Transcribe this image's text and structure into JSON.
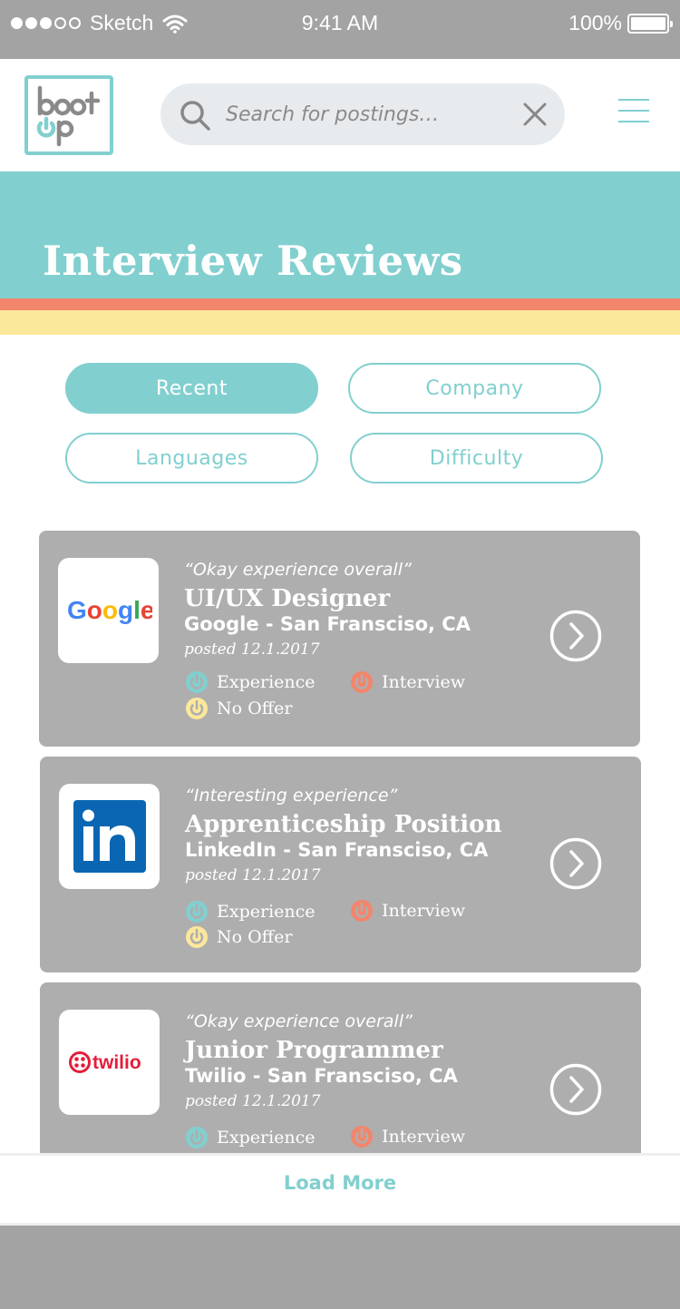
{
  "status_bar": {
    "carrier": "Sketch",
    "time": "9:41 AM",
    "battery": "100%",
    "signal_bars_filled": 3,
    "signal_bars_total": 5
  },
  "header": {
    "logo_text": "boot up",
    "search_placeholder": "Search for postings…",
    "search_value": "",
    "icons": [
      "search-icon",
      "close-icon",
      "hamburger-menu-icon"
    ]
  },
  "banner": {
    "title": "Interview Reviews"
  },
  "filters": [
    {
      "label": "Recent",
      "active": true
    },
    {
      "label": "Company",
      "active": false
    },
    {
      "label": "Languages",
      "active": false
    },
    {
      "label": "Difficulty",
      "active": false
    }
  ],
  "reviews": [
    {
      "quote": "“Okay experience overall”",
      "title": "UI/UX Designer",
      "company": "Google - San Fransciso, CA",
      "posted": "posted 12.1.2017",
      "logo": "Google",
      "tags": {
        "experience": "Experience",
        "interview": "Interview",
        "offer": "No Offer"
      }
    },
    {
      "quote": "“Interesting experience”",
      "title": "Apprenticeship Position",
      "company": "LinkedIn - San Fransciso, CA",
      "posted": "posted 12.1.2017",
      "logo": "in",
      "tags": {
        "experience": "Experience",
        "interview": "Interview",
        "offer": "No Offer"
      }
    },
    {
      "quote": "“Okay experience overall”",
      "title": "Junior Programmer",
      "company": "Twilio - San Fransciso, CA",
      "posted": "posted 12.1.2017",
      "logo": "twilio",
      "tags": {
        "experience": "Experience",
        "interview": "Interview"
      }
    }
  ],
  "load_more": "Load More",
  "colors": {
    "accent": "#82cfcf",
    "coral": "#f2866c",
    "yellow": "#fce89b",
    "card": "#aeaeae",
    "tag_experience": "#82cfcf",
    "tag_interview": "#f2866c",
    "tag_offer": "#fce89b"
  }
}
